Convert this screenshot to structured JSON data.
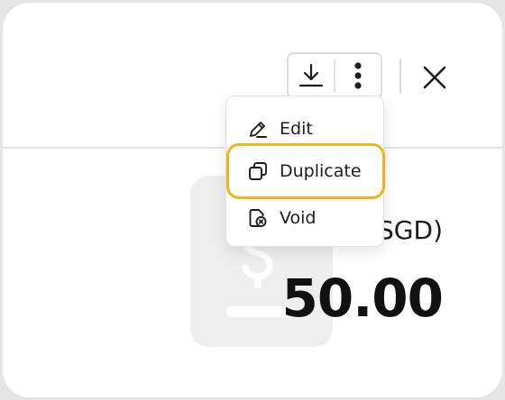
{
  "toolbar": {
    "download_icon": "download-icon",
    "more_icon": "more-vertical-icon",
    "close_icon": "close-icon"
  },
  "menu": {
    "items": [
      {
        "label": "Edit",
        "icon": "pencil-icon"
      },
      {
        "label": "Duplicate",
        "icon": "duplicate-icon"
      },
      {
        "label": "Void",
        "icon": "void-icon"
      }
    ],
    "highlight_color": "#f0b41c"
  },
  "summary": {
    "currency_label": "SGD)",
    "amount": "50.00"
  }
}
